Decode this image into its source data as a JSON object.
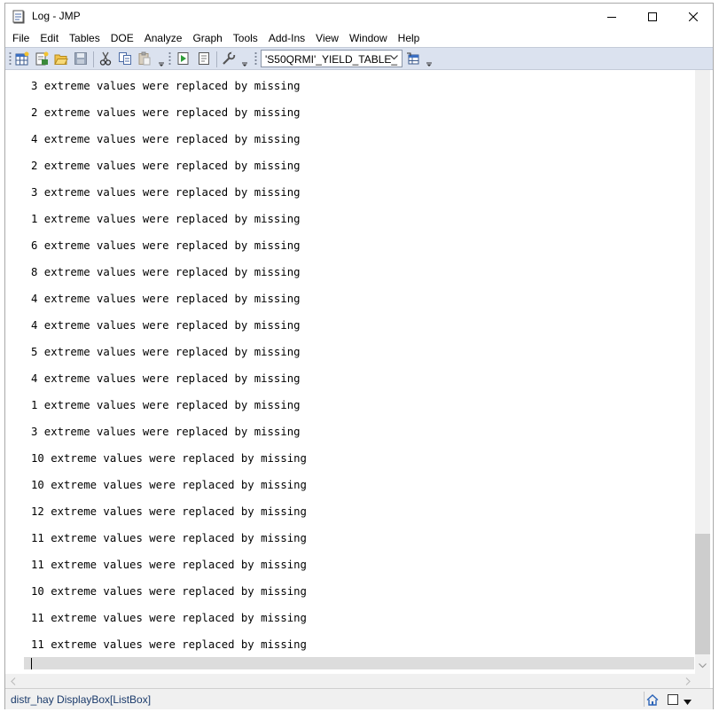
{
  "window": {
    "title": "Log - JMP",
    "controls": [
      "minimize-icon",
      "maximize-icon",
      "close-icon"
    ]
  },
  "menu": [
    "File",
    "Edit",
    "Tables",
    "DOE",
    "Analyze",
    "Graph",
    "Tools",
    "Add-Ins",
    "View",
    "Window",
    "Help"
  ],
  "toolbar": {
    "buttons": [
      "new-data-table-icon",
      "new-script-icon",
      "open-folder-icon",
      "save-icon",
      "cut-icon",
      "copy-icon",
      "paste-icon",
      "run-script-icon",
      "journal-icon",
      "tools-wrench-icon",
      "table-link-icon"
    ],
    "table_select_value": "'S50QRMI'_YIELD_TABLE_"
  },
  "log": {
    "lines": [
      "3 extreme values were replaced by missing",
      "2 extreme values were replaced by missing",
      "4 extreme values were replaced by missing",
      "2 extreme values were replaced by missing",
      "3 extreme values were replaced by missing",
      "1 extreme values were replaced by missing",
      "6 extreme values were replaced by missing",
      "8 extreme values were replaced by missing",
      "4 extreme values were replaced by missing",
      "4 extreme values were replaced by missing",
      "5 extreme values were replaced by missing",
      "4 extreme values were replaced by missing",
      "1 extreme values were replaced by missing",
      "3 extreme values were replaced by missing",
      "10 extreme values were replaced by missing",
      "10 extreme values were replaced by missing",
      "12 extreme values were replaced by missing",
      "11 extreme values were replaced by missing",
      "11 extreme values were replaced by missing",
      "10 extreme values were replaced by missing",
      "11 extreme values were replaced by missing",
      "11 extreme values were replaced by missing"
    ],
    "vertical_scroll_fraction": 0.86
  },
  "status": {
    "text": "distr_hay  DisplayBox[ListBox]"
  }
}
